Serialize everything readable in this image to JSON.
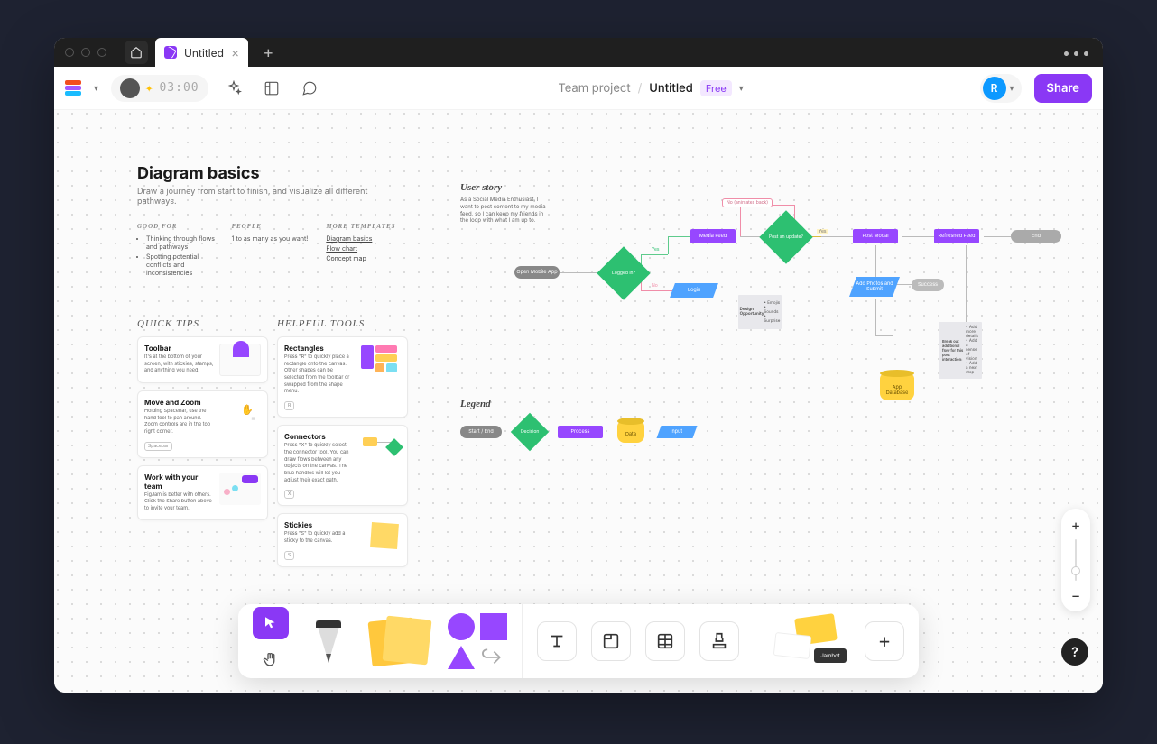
{
  "window": {
    "tab_name": "Untitled"
  },
  "toolbar": {
    "timer": "03:00",
    "team": "Team project",
    "sep": "/",
    "file": "Untitled",
    "plan": "Free",
    "user_initial": "R",
    "share": "Share"
  },
  "doc": {
    "title": "Diagram basics",
    "subtitle": "Draw a journey from start to finish, and visualize all different pathways.",
    "good_for_h": "GOOD FOR",
    "good_for": [
      "Thinking through flows and pathways",
      "Spotting potential conflicts and inconsistencies"
    ],
    "people_h": "PEOPLE",
    "people": "1 to as many as you want!",
    "more_h": "MORE TEMPLATES",
    "templates": [
      "Diagram basics",
      "Flow chart",
      "Concept map"
    ],
    "quick_tips_h": "QUICK TIPS",
    "helpful_tools_h": "HELPFUL TOOLS",
    "tips_left": [
      {
        "title": "Toolbar",
        "body": "It's at the bottom of your screen, with stickies, stamps, and anything you need.",
        "key": ""
      },
      {
        "title": "Move and Zoom",
        "body": "Holding Spacebar, use the hand tool to pan around. Zoom controls are in the top right corner.",
        "key": "Spacebar"
      },
      {
        "title": "Work with your team",
        "body": "FigJam is better with others. Click the Share button above to invite your team.",
        "key": ""
      }
    ],
    "tips_right": [
      {
        "title": "Rectangles",
        "body": "Press \"R\" to quickly place a rectangle onto the canvas. Other shapes can be selected from the toolbar or swapped from the shape menu.",
        "key": "R"
      },
      {
        "title": "Connectors",
        "body": "Press \"X\" to quickly select the connector tool. You can draw flows between any objects on the canvas. The blue handles will let you adjust their exact path.",
        "key": "X"
      },
      {
        "title": "Stickies",
        "body": "Press \"S\" to quickly add a sticky to the canvas.",
        "key": "S"
      }
    ]
  },
  "flow": {
    "heading": "User story",
    "story": "As a Social Media Enthusiast, I want to post content to my media feed, so I can keep my friends in the loop with what I am up to.",
    "nodes": {
      "open": "Open Mobile App",
      "logged": "Logged in?",
      "login": "Login",
      "feed": "Media Feed",
      "no_back": "No (animates back)",
      "post_update": "Post an update?",
      "post_modal": "Post Modal",
      "add_photos": "Add Photos and Submit",
      "success": "Success",
      "refreshed": "Refreshed Feed",
      "end": "End",
      "db": "App Database",
      "opp_h": "Design Opportunity",
      "opp_items": "• Emojis\n• Sounds\n• Surprise",
      "detail_h": "Break out additional flow for this post interaction:",
      "detail_items": "• Add more details\n• Add a sense of vision\n• Add a next step"
    },
    "labels": {
      "yes": "Yes",
      "no": "No"
    }
  },
  "legend": {
    "heading": "Legend",
    "start": "Start / End",
    "decision": "Decision",
    "process": "Process",
    "data": "Data",
    "input": "Input"
  },
  "help": "?"
}
